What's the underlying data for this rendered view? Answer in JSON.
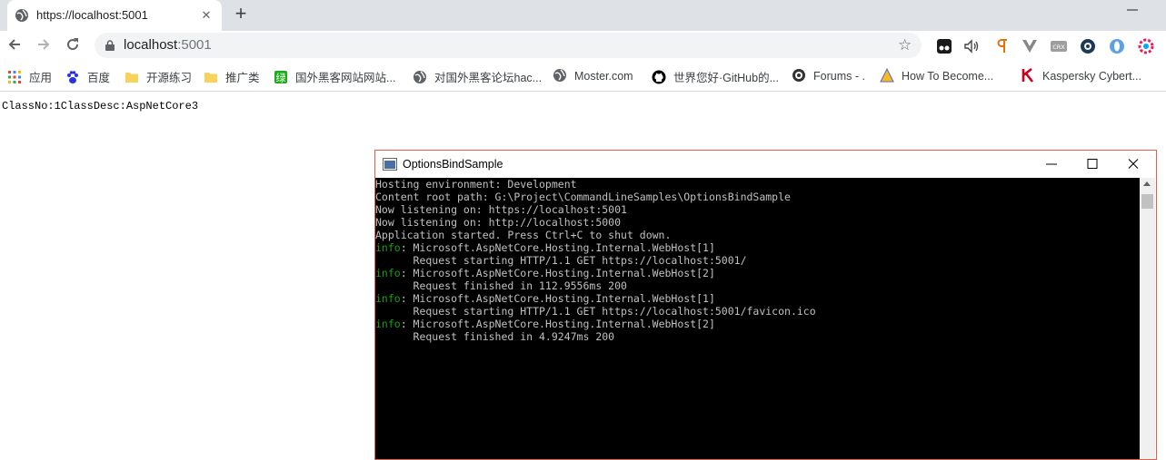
{
  "browser": {
    "tab": {
      "title": "https://localhost:5001"
    },
    "address": {
      "host": "localhost",
      "port": ":5001"
    },
    "bookmarks": [
      {
        "label": "应用",
        "icon": "apps-grid-icon"
      },
      {
        "label": "百度",
        "icon": "baidu-paw-icon"
      },
      {
        "label": "开源练习",
        "icon": "folder-icon"
      },
      {
        "label": "推广类",
        "icon": "folder-icon"
      },
      {
        "label": "国外黑客网站网站...",
        "icon": "green-site-icon"
      },
      {
        "label": "对国外黑客论坛hac...",
        "icon": "globe-icon"
      },
      {
        "label": "Moster.com",
        "icon": "globe-icon"
      },
      {
        "label": "世界您好·GitHub的...",
        "icon": "github-icon"
      },
      {
        "label": "Forums - .",
        "icon": "forum-icon"
      },
      {
        "label": "How To Become...",
        "icon": "pyramid-icon"
      },
      {
        "label": "Kaspersky Cybert...",
        "icon": "kaspersky-icon"
      }
    ],
    "extensions": [
      "tampermonkey-icon",
      "audio-icon",
      "paragraph-icon",
      "vue-icon",
      "crx-icon",
      "compass-icon",
      "opera-icon",
      "settings-gear-icon"
    ]
  },
  "page": {
    "text": "ClassNo:1ClassDesc:AspNetCore3"
  },
  "console": {
    "title": "OptionsBindSample",
    "lines": [
      {
        "level": "",
        "text": "Hosting environment: Development"
      },
      {
        "level": "",
        "text": "Content root path: G:\\Project\\CommandLineSamples\\OptionsBindSample"
      },
      {
        "level": "",
        "text": "Now listening on: https://localhost:5001"
      },
      {
        "level": "",
        "text": "Now listening on: http://localhost:5000"
      },
      {
        "level": "",
        "text": "Application started. Press Ctrl+C to shut down."
      },
      {
        "level": "info",
        "text": ": Microsoft.AspNetCore.Hosting.Internal.WebHost[1]"
      },
      {
        "level": "",
        "text": "      Request starting HTTP/1.1 GET https://localhost:5001/"
      },
      {
        "level": "info",
        "text": ": Microsoft.AspNetCore.Hosting.Internal.WebHost[2]"
      },
      {
        "level": "",
        "text": "      Request finished in 112.9556ms 200"
      },
      {
        "level": "info",
        "text": ": Microsoft.AspNetCore.Hosting.Internal.WebHost[1]"
      },
      {
        "level": "",
        "text": "      Request starting HTTP/1.1 GET https://localhost:5001/favicon.ico"
      },
      {
        "level": "info",
        "text": ": Microsoft.AspNetCore.Hosting.Internal.WebHost[2]"
      },
      {
        "level": "",
        "text": "      Request finished in 4.9247ms 200"
      }
    ]
  }
}
